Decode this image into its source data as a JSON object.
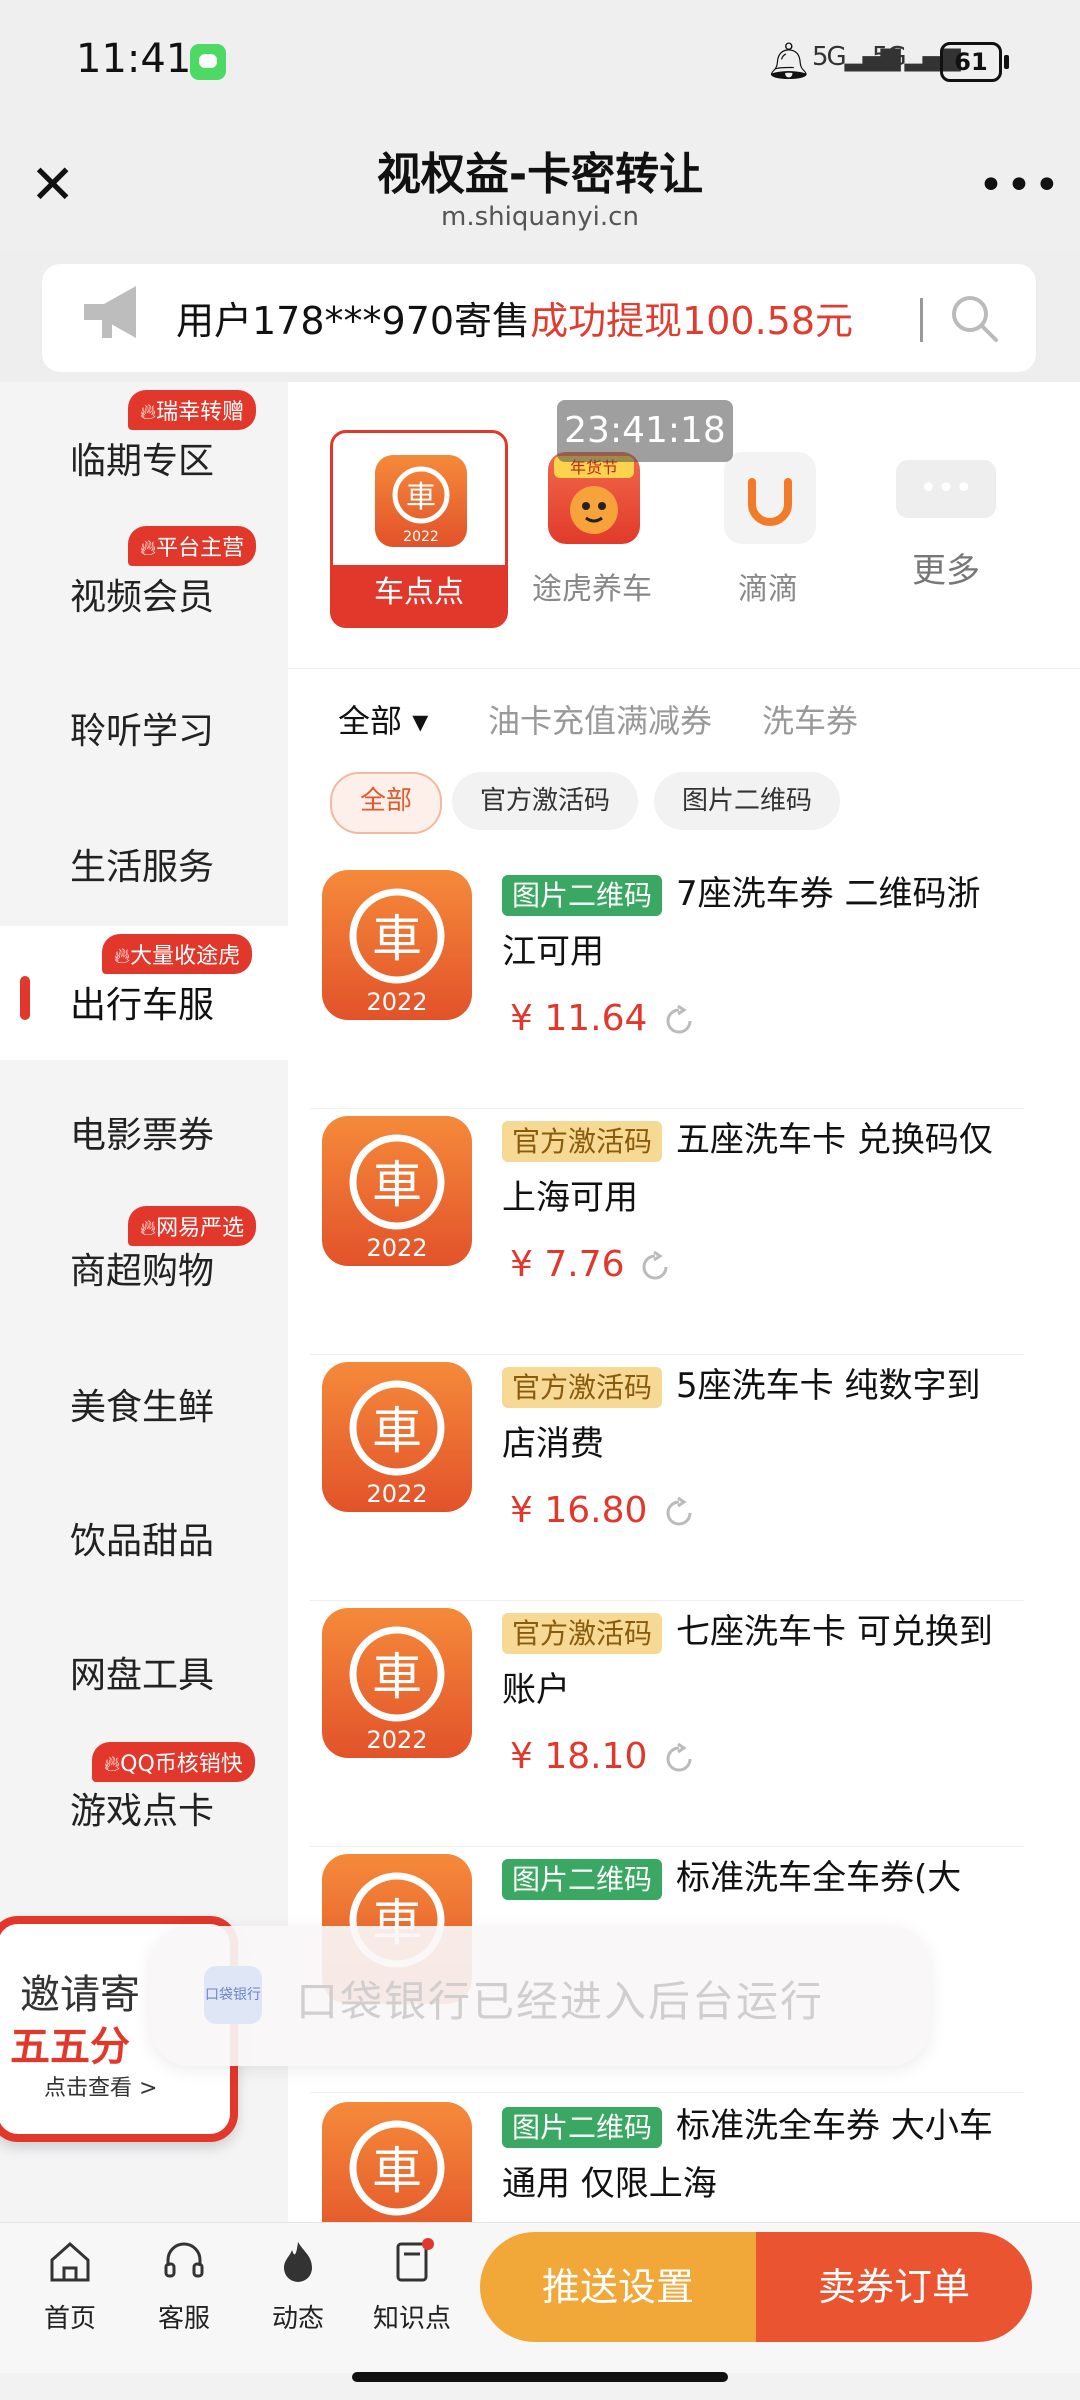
{
  "status_bar": {
    "time": "11:41",
    "sig1": "5G",
    "sig2": "5G",
    "battery": "61"
  },
  "header": {
    "title": "视权益-卡密转让",
    "url": "m.shiquanyi.cn",
    "more": "•••"
  },
  "notice": {
    "prefix": "用户178***970寄售",
    "highlight": "成功提现100.58元"
  },
  "sidebar": {
    "items": [
      {
        "label": "临期专区",
        "badge": "瑞幸转赠"
      },
      {
        "label": "视频会员",
        "badge": "平台主营"
      },
      {
        "label": "聆听学习",
        "badge": ""
      },
      {
        "label": "生活服务",
        "badge": ""
      },
      {
        "label": "出行车服",
        "badge": "大量收途虎"
      },
      {
        "label": "电影票券",
        "badge": ""
      },
      {
        "label": "商超购物",
        "badge": "网易严选"
      },
      {
        "label": "美食生鲜",
        "badge": ""
      },
      {
        "label": "饮品甜品",
        "badge": ""
      },
      {
        "label": "网盘工具",
        "badge": ""
      },
      {
        "label": "游戏点卡",
        "badge": "QQ币核销快"
      }
    ]
  },
  "overlay_time": "23:41:18",
  "brand_tabs": [
    {
      "label": "车点点",
      "icon_text": "2022"
    },
    {
      "label": "途虎养车",
      "icon_text": "年货节"
    },
    {
      "label": "滴滴",
      "icon_text": ""
    },
    {
      "label": "更多",
      "icon_text": "•••"
    }
  ],
  "filters": {
    "main": [
      "全部",
      "油卡充值满减券",
      "洗车券"
    ],
    "chips": [
      "全部",
      "官方激活码",
      "图片二维码"
    ]
  },
  "products": [
    {
      "tag": "图片二维码",
      "tag_color": "green",
      "title": "7座洗车券 二维码浙江可用",
      "price": "¥ 11.64"
    },
    {
      "tag": "官方激活码",
      "tag_color": "yellow",
      "title": "五座洗车卡 兑换码仅上海可用",
      "price": "¥ 7.76"
    },
    {
      "tag": "官方激活码",
      "tag_color": "yellow",
      "title": "5座洗车卡 纯数字到店消费",
      "price": "¥ 16.80"
    },
    {
      "tag": "官方激活码",
      "tag_color": "yellow",
      "title": "七座洗车卡 可兑换到账户",
      "price": "¥ 18.10"
    },
    {
      "tag": "图片二维码",
      "tag_color": "green",
      "title": "标准洗车全车券(大",
      "price": ""
    },
    {
      "tag": "图片二维码",
      "tag_color": "green",
      "title": "标准洗全车券 大小车通用 仅限上海",
      "price": ""
    }
  ],
  "invite": {
    "line1": "邀请寄",
    "line2": "五五分",
    "line3": "点击查看 >"
  },
  "toast": {
    "icon_text": "口袋银行",
    "text": "口袋银行已经进入后台运行"
  },
  "bottom_nav": {
    "items": [
      "首页",
      "客服",
      "动态",
      "知识点"
    ],
    "push_button": "推送设置",
    "orders_button": "卖券订单"
  },
  "colors": {
    "accent": "#e2372b",
    "orange": "#f1a839",
    "tag_green": "#3aa763",
    "tag_yellow": "#f6d994"
  }
}
